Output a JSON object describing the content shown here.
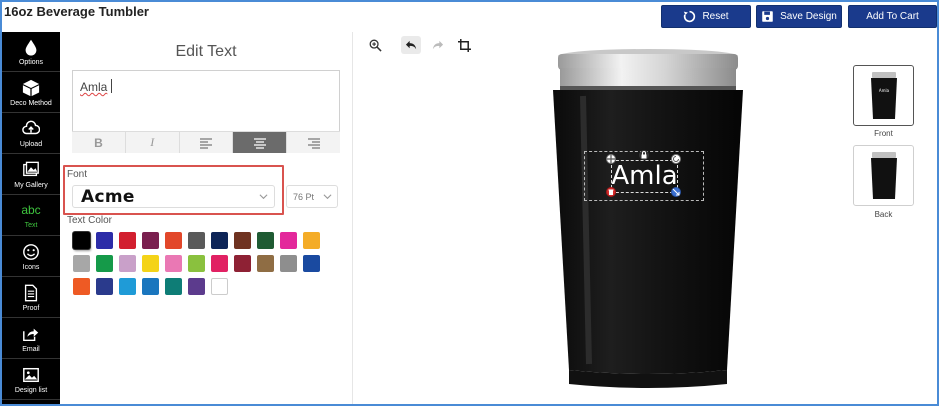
{
  "app": {
    "title": "16oz Beverage Tumbler"
  },
  "toolbar": {
    "reset_label": "Reset",
    "save_label": "Save Design",
    "cart_label": "Add To Cart"
  },
  "sidebar": {
    "items": [
      {
        "label": "Options",
        "icon": "drop-icon"
      },
      {
        "label": "Deco Method",
        "icon": "box-icon"
      },
      {
        "label": "Upload",
        "icon": "upload-icon"
      },
      {
        "label": "My Gallery",
        "icon": "gallery-icon"
      },
      {
        "label": "Text",
        "icon": "abc-icon",
        "active": true,
        "icon_text": "abc"
      },
      {
        "label": "Icons",
        "icon": "smiley-icon"
      },
      {
        "label": "Proof",
        "icon": "proof-icon"
      },
      {
        "label": "Email",
        "icon": "share-icon"
      },
      {
        "label": "Design list",
        "icon": "image-icon"
      }
    ]
  },
  "edit_panel": {
    "title": "Edit Text",
    "text_value": "Amla",
    "format_buttons": [
      "B",
      "I",
      "align-left",
      "align-center",
      "align-right"
    ],
    "active_format": "align-center",
    "font_label": "Font",
    "font_value": "Acme",
    "size_value": "76 Pt",
    "text_color_label": "Text Color",
    "colors": [
      "#000000",
      "#2c2ca8",
      "#d21f2f",
      "#7a1f4f",
      "#e2472a",
      "#5a5a5a",
      "#0d2457",
      "#6f3321",
      "#1f5b33",
      "#e3289b",
      "#f4ac27",
      "#a7a7a7",
      "#159a49",
      "#c9a0c9",
      "#f4d318",
      "#ea78b4",
      "#8ac13e",
      "#e12163",
      "#8e2134",
      "#8f6d44",
      "#8e8e8e",
      "#1a4aa0",
      "#ee5a24",
      "#2a3a8c",
      "#1f9bd7",
      "#1a76be",
      "#0e7d76",
      "#5c3b8d",
      "#ffffff"
    ],
    "selected_color": "#000000"
  },
  "canvas": {
    "design_text": "Amla",
    "design_text_color": "#ffffff",
    "product_color": "#111111"
  },
  "views": [
    {
      "label": "Front",
      "active": true,
      "thumb_text": "Amla"
    },
    {
      "label": "Back",
      "active": false
    }
  ]
}
